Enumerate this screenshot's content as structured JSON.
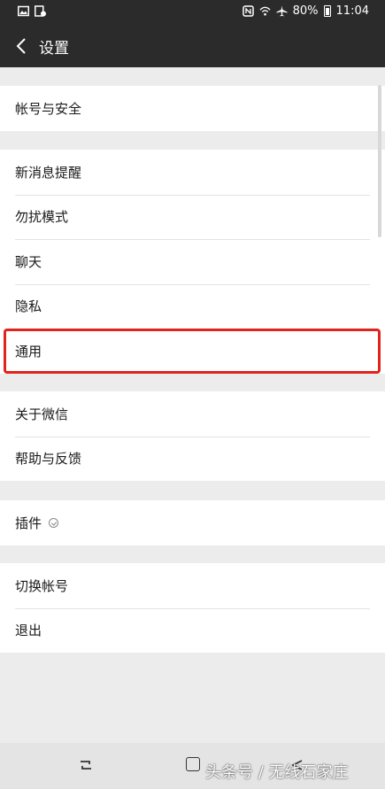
{
  "status_bar": {
    "battery_percent": "80%",
    "time": "11:04",
    "icons_left": [
      "gallery-icon",
      "notification-icon"
    ],
    "icons_right": [
      "nfc-icon",
      "wifi-icon",
      "airplane-icon",
      "battery-icon"
    ]
  },
  "header": {
    "title": "设置",
    "back_icon": "chevron-left-icon"
  },
  "groups": [
    {
      "items": [
        {
          "label": "帐号与安全"
        }
      ]
    },
    {
      "items": [
        {
          "label": "新消息提醒"
        },
        {
          "label": "勿扰模式"
        },
        {
          "label": "聊天"
        },
        {
          "label": "隐私"
        },
        {
          "label": "通用",
          "highlighted": true
        }
      ]
    },
    {
      "items": [
        {
          "label": "关于微信"
        },
        {
          "label": "帮助与反馈"
        }
      ]
    },
    {
      "items": [
        {
          "label": "插件",
          "badge_icon": "plugin-badge-icon"
        }
      ]
    },
    {
      "items": [
        {
          "label": "切换帐号"
        },
        {
          "label": "退出"
        }
      ]
    }
  ],
  "highlight_color": "#e0241c",
  "watermark": "头条号 / 无线石家庄",
  "colors": {
    "header_bg": "#2b2b2b",
    "page_bg": "#ececec"
  }
}
